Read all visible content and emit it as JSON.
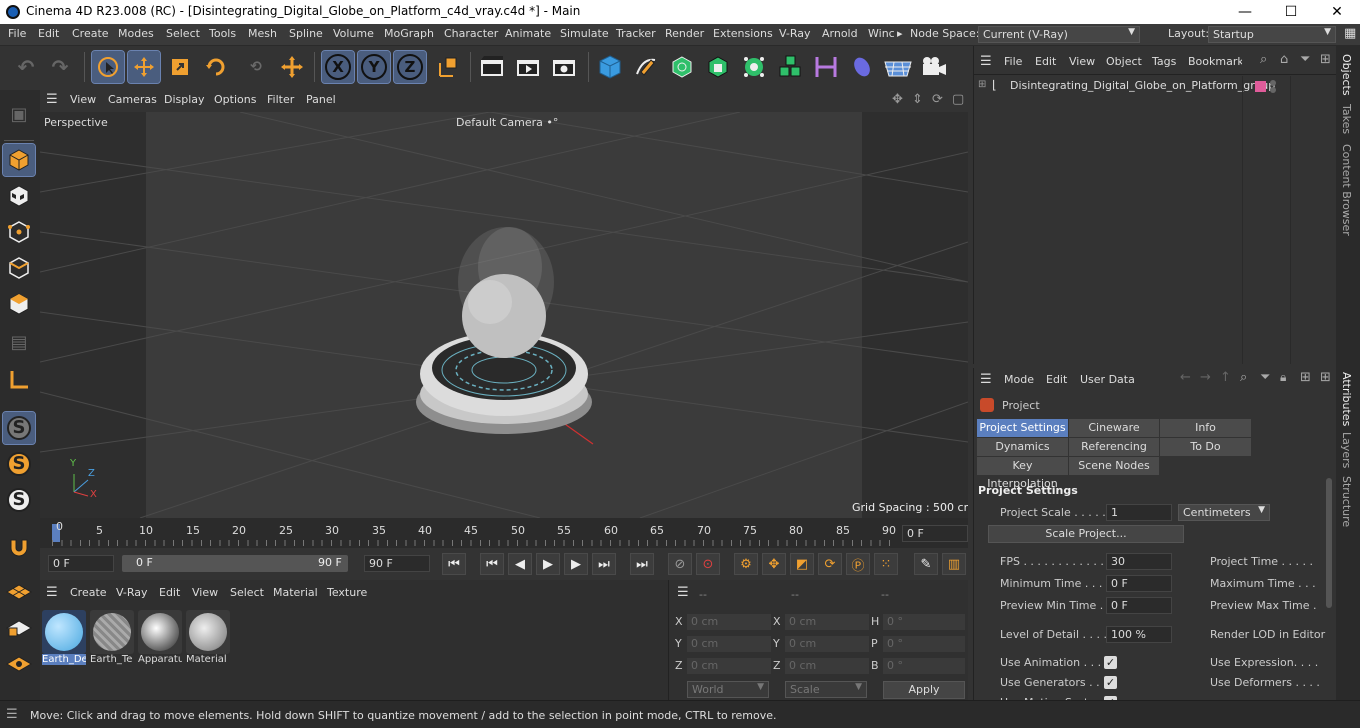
{
  "window": {
    "title": "Cinema 4D R23.008 (RC) - [Disintegrating_Digital_Globe_on_Platform_c4d_vray.c4d *] - Main",
    "minimize": "—",
    "maximize": "☐",
    "close": "✕"
  },
  "menubar": {
    "items": [
      "File",
      "Edit",
      "Create",
      "Modes",
      "Select",
      "Tools",
      "Mesh",
      "Spline",
      "Volume",
      "MoGraph",
      "Character",
      "Animate",
      "Simulate",
      "Tracker",
      "Render",
      "Extensions",
      "V-Ray",
      "Arnold",
      "Winc"
    ],
    "overflow_arrow": "▸",
    "node_space_label": "Node Space:",
    "node_space_value": "Current (V-Ray)",
    "layout_label": "Layout:",
    "layout_value": "Startup"
  },
  "toolbar": {
    "axis_x": "X",
    "axis_y": "Y",
    "axis_z": "Z"
  },
  "viewport": {
    "menu": [
      "View",
      "Cameras",
      "Display",
      "Options",
      "Filter",
      "Panel"
    ],
    "label": "Perspective",
    "camera": "Default Camera",
    "camera_icon": "•°",
    "grid_spacing": "Grid Spacing : 500 cm",
    "axis_y": "Y",
    "axis_z": "Z",
    "axis_x": "X"
  },
  "timeline": {
    "ticks": [
      "0",
      "5",
      "10",
      "15",
      "20",
      "25",
      "30",
      "35",
      "40",
      "45",
      "50",
      "55",
      "60",
      "65",
      "70",
      "75",
      "80",
      "85",
      "90"
    ],
    "current_frame": "0 F",
    "start_frame": "0 F",
    "range_start": "0 F",
    "range_end": "90 F",
    "end_frame": "90 F"
  },
  "material_manager": {
    "menu": [
      "Create",
      "V-Ray",
      "Edit",
      "View",
      "Select",
      "Material",
      "Texture"
    ],
    "materials": [
      "Earth_De",
      "Earth_Te",
      "Apparatu",
      "Material"
    ]
  },
  "coordinates": {
    "header": [
      "--",
      "--",
      "--"
    ],
    "rows": [
      {
        "a": "X",
        "av": "0 cm",
        "b": "X",
        "bv": "0 cm",
        "c": "H",
        "cv": "0 °"
      },
      {
        "a": "Y",
        "av": "0 cm",
        "b": "Y",
        "bv": "0 cm",
        "c": "P",
        "cv": "0 °"
      },
      {
        "a": "Z",
        "av": "0 cm",
        "b": "Z",
        "bv": "0 cm",
        "c": "B",
        "cv": "0 °"
      }
    ],
    "world": "World",
    "scale": "Scale",
    "apply": "Apply"
  },
  "objects_panel": {
    "menu": [
      "File",
      "Edit",
      "View",
      "Object",
      "Tags",
      "Bookmarks"
    ],
    "object_name": "Disintegrating_Digital_Globe_on_Platform_group",
    "tag_color": "#e05c9a"
  },
  "attributes_panel": {
    "menu": [
      "Mode",
      "Edit",
      "User Data"
    ],
    "object_label": "Project",
    "tabs_row1": [
      "Project Settings",
      "Cineware",
      "Info"
    ],
    "tabs_row2": [
      "Dynamics",
      "Referencing",
      "To Do"
    ],
    "tabs_row3": [
      "Key Interpolation",
      "Scene Nodes"
    ],
    "section": "Project Settings",
    "project_scale_label": "Project Scale . . . . .",
    "project_scale_value": "1",
    "project_scale_unit": "Centimeters",
    "scale_project_button": "Scale Project...",
    "fps_label": "FPS . . . . . . . . . . . .",
    "fps_value": "30",
    "project_time_label": "Project Time . . . . .",
    "min_time_label": "Minimum Time . . .",
    "min_time_value": "0 F",
    "max_time_label": "Maximum Time . . .",
    "preview_min_label": "Preview Min Time . .",
    "preview_min_value": "0 F",
    "preview_max_label": "Preview Max Time .",
    "lod_label": "Level of Detail . . . .",
    "lod_value": "100 %",
    "render_lod_label": "Render LOD in Editor",
    "use_animation": "Use Animation . . . .",
    "use_expression": "Use Expression. . . .",
    "use_generators": "Use Generators . . .",
    "use_deformers": "Use Deformers . . . .",
    "use_motion_system": "Use Motion System",
    "check": "✓"
  },
  "right_tabs": [
    "Objects",
    "Takes",
    "Content Browser",
    "Attributes",
    "Layers",
    "Structure"
  ],
  "statusbar": {
    "text": "Move: Click and drag to move elements. Hold down SHIFT to quantize movement / add to the selection in point mode, CTRL to remove."
  },
  "colors": {
    "accent": "#5b7fbf",
    "x_axis": "#e04040",
    "y_axis": "#5fbf4a",
    "z_axis": "#4a9fe0",
    "tool_orange": "#f0a030"
  }
}
